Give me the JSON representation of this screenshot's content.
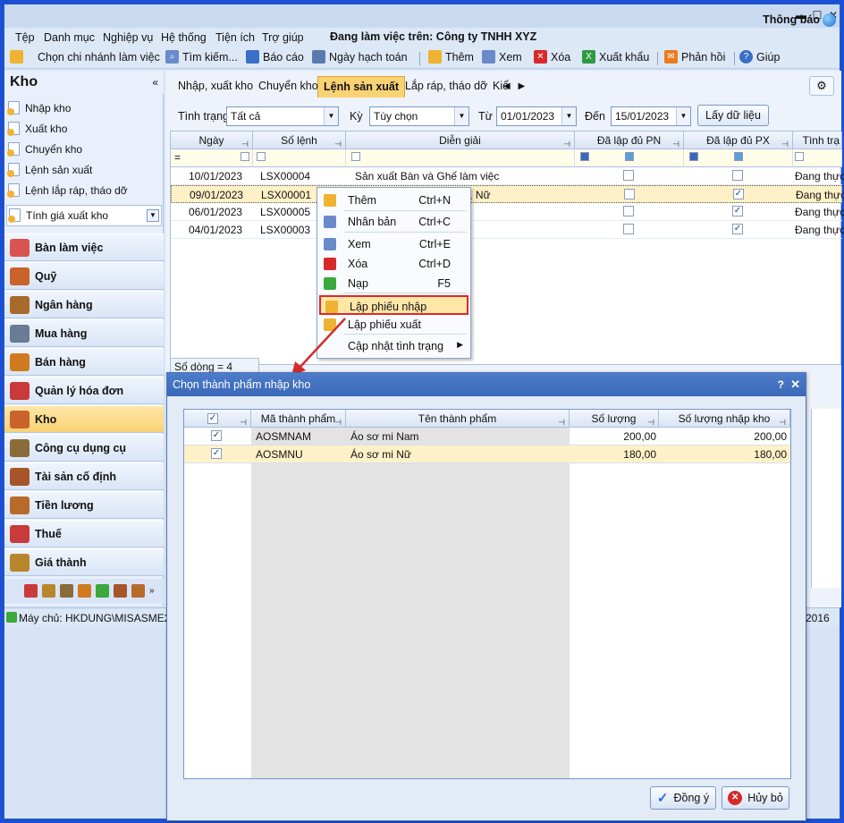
{
  "window": {
    "minimize": "▬",
    "maximize": "☐",
    "close": "✕"
  },
  "menu": {
    "items": [
      "Tệp",
      "Danh mục",
      "Nghiệp vụ",
      "Hệ thống",
      "Tiện ích",
      "Trợ giúp"
    ],
    "working_on": "Đang làm việc trên: Công ty TNHH XYZ",
    "notice": "Thông báo"
  },
  "toolbar": {
    "branch": "Chọn chi nhánh làm việc",
    "search": "Tìm kiếm...",
    "report": "Báo cáo",
    "posting_date": "Ngày hạch toán",
    "add": "Thêm",
    "view": "Xem",
    "delete": "Xóa",
    "export": "Xuất khẩu",
    "feedback": "Phản hồi",
    "help": "Giúp"
  },
  "sidebar": {
    "title": "Kho",
    "collapse": "«",
    "tasks": [
      "Nhập kho",
      "Xuất kho",
      "Chuyển kho",
      "Lệnh sản xuất",
      "Lệnh lắp ráp, tháo dỡ"
    ],
    "combo": "Tính giá xuất kho",
    "modules": [
      {
        "label": "Bàn làm việc",
        "icon": "desk-icon",
        "color": "#d9534f"
      },
      {
        "label": "Quỹ",
        "icon": "cash-icon",
        "color": "#c9622b"
      },
      {
        "label": "Ngân hàng",
        "icon": "bank-icon",
        "color": "#a76a2b"
      },
      {
        "label": "Mua hàng",
        "icon": "cart-icon",
        "color": "#6a7b95"
      },
      {
        "label": "Bán hàng",
        "icon": "sale-icon",
        "color": "#d07a1f"
      },
      {
        "label": "Quản lý hóa đơn",
        "icon": "invoice-icon",
        "color": "#c93a3a"
      },
      {
        "label": "Kho",
        "icon": "warehouse-icon",
        "color": "#c9622b"
      },
      {
        "label": "Công cụ dụng cụ",
        "icon": "tools-icon",
        "color": "#8a6b3a"
      },
      {
        "label": "Tài sản cố định",
        "icon": "asset-icon",
        "color": "#a8542b"
      },
      {
        "label": "Tiền lương",
        "icon": "salary-icon",
        "color": "#b86a2b"
      },
      {
        "label": "Thuế",
        "icon": "tax-icon",
        "color": "#c93a3a"
      },
      {
        "label": "Giá thành",
        "icon": "cost-icon",
        "color": "#b8862b"
      }
    ]
  },
  "status": {
    "server": "Máy chủ: HKDUNG\\MISASME201",
    "year_tail": "2016"
  },
  "main": {
    "tabs": [
      "Nhập, xuất kho",
      "Chuyển kho",
      "Lệnh sản xuất",
      "Lắp ráp, tháo dỡ",
      "Kiể"
    ],
    "active_tab": 2,
    "filters": {
      "status_label": "Tình trạng",
      "status_value": "Tất cả",
      "period_label": "Kỳ",
      "period_value": "Tùy chọn",
      "from_label": "Từ",
      "from_value": "01/01/2023",
      "to_label": "Đến",
      "to_value": "15/01/2023",
      "load_button": "Lấy dữ liệu"
    },
    "grid": {
      "columns": [
        "Ngày",
        "Số lệnh",
        "Diễn giải",
        "Đã lập đủ PN",
        "Đã lập đủ PX",
        "Tình trạ"
      ],
      "filter_eq": "=",
      "rows": [
        {
          "date": "10/01/2023",
          "code": "LSX00004",
          "desc": "Sản xuất Bàn và Ghế làm việc",
          "pn": false,
          "px": false,
          "status": "Đang thực"
        },
        {
          "date": "09/01/2023",
          "code": "LSX00001",
          "desc": "Sản xuất Áo sơ mi Nam, Nữ",
          "pn": false,
          "px": true,
          "status": "Đang thực"
        },
        {
          "date": "06/01/2023",
          "code": "LSX00005",
          "desc": "",
          "pn": false,
          "px": true,
          "status": "Đang thực"
        },
        {
          "date": "04/01/2023",
          "code": "LSX00003",
          "desc": "việc",
          "pn": false,
          "px": true,
          "status": "Đang thực"
        }
      ],
      "row_count": "Số dòng = 4"
    }
  },
  "context_menu": {
    "items": [
      {
        "label": "Thêm",
        "shortcut": "Ctrl+N",
        "icon": "add-icon",
        "color": "#f0b232"
      },
      {
        "label": "Nhân bản",
        "shortcut": "Ctrl+C",
        "icon": "duplicate-icon",
        "color": "#6a8ac9"
      },
      {
        "label": "Xem",
        "shortcut": "Ctrl+E",
        "icon": "view-icon",
        "color": "#6a8ac9"
      },
      {
        "label": "Xóa",
        "shortcut": "Ctrl+D",
        "icon": "delete-icon",
        "color": "#d62a2a"
      },
      {
        "label": "Nạp",
        "shortcut": "F5",
        "icon": "reload-icon",
        "color": "#3aa83a"
      },
      {
        "label": "Lập phiếu nhập",
        "shortcut": "",
        "icon": "receipt-in-icon",
        "color": "#f0b232"
      },
      {
        "label": "Lập phiếu xuất",
        "shortcut": "",
        "icon": "receipt-out-icon",
        "color": "#f0b232"
      },
      {
        "label": "Cập nhật tình trạng",
        "shortcut": "",
        "icon": "",
        "color": ""
      }
    ],
    "highlighted": 5
  },
  "dialog": {
    "title": "Chọn thành phẩm nhập kho",
    "help": "?",
    "close": "✕",
    "columns": [
      "Mã thành phẩm",
      "Tên thành phẩm",
      "Số lượng",
      "Số lượng nhập kho"
    ],
    "rows": [
      {
        "checked": true,
        "code": "AOSMNAM",
        "name": "Áo sơ mi Nam",
        "qty": "200,00",
        "qty_in": "200,00"
      },
      {
        "checked": true,
        "code": "AOSMNU",
        "name": "Áo sơ mi Nữ",
        "qty": "180,00",
        "qty_in": "180,00"
      }
    ],
    "ok": "Đồng ý",
    "cancel": "Hủy bỏ"
  }
}
